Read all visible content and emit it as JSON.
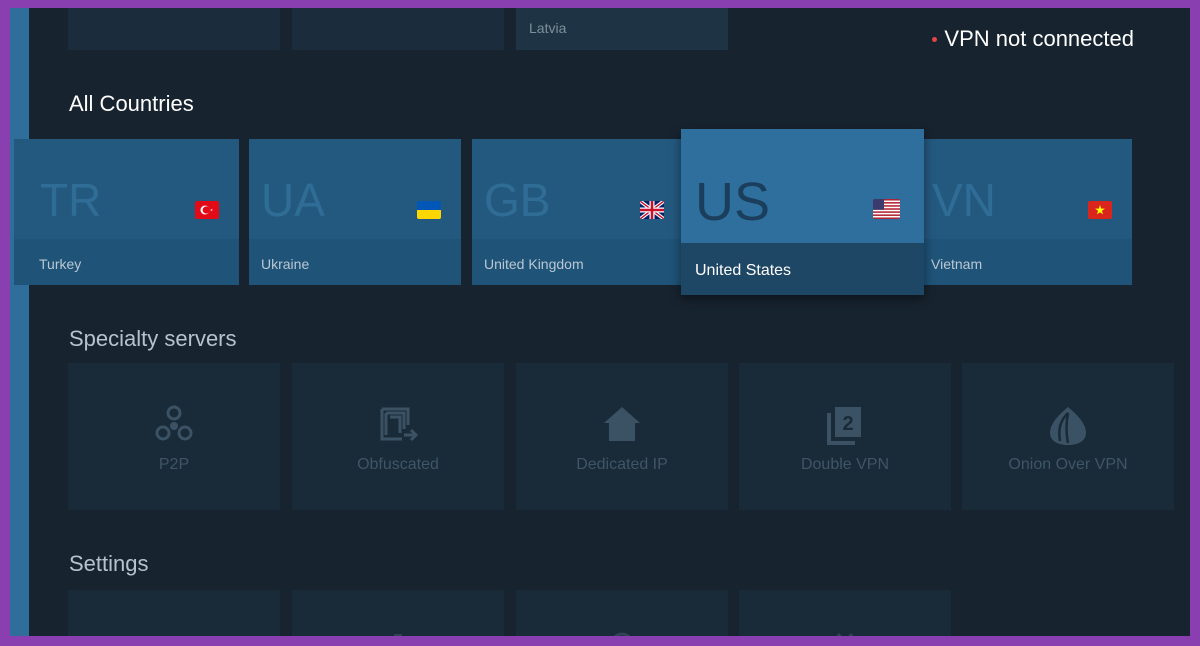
{
  "top_row": {
    "tiles": [
      {
        "label": ""
      },
      {
        "label": ""
      },
      {
        "label": "Latvia"
      }
    ]
  },
  "status": {
    "text": "VPN not connected",
    "dot_color": "#e5434a"
  },
  "sections": {
    "countries_title": "All Countries",
    "specialty_title": "Specialty servers",
    "settings_title": "Settings"
  },
  "countries": [
    {
      "code": "TR",
      "name": "Turkey",
      "flag": "flag-tr-icon"
    },
    {
      "code": "UA",
      "name": "Ukraine",
      "flag": "flag-ua-icon"
    },
    {
      "code": "GB",
      "name": "United Kingdom",
      "flag": "flag-gb-icon"
    },
    {
      "code": "US",
      "name": "United States",
      "flag": "flag-us-icon",
      "focused": true
    },
    {
      "code": "VN",
      "name": "Vietnam",
      "flag": "flag-vn-icon"
    }
  ],
  "specialty": [
    {
      "label": "P2P",
      "icon": "p2p-icon"
    },
    {
      "label": "Obfuscated",
      "icon": "obfuscated-icon"
    },
    {
      "label": "Dedicated IP",
      "icon": "house-icon"
    },
    {
      "label": "Double VPN",
      "icon": "double-vpn-icon"
    },
    {
      "label": "Onion Over VPN",
      "icon": "onion-icon"
    }
  ],
  "settings": [
    {
      "icon": "settings-item-icon"
    },
    {
      "icon": "settings-item-icon"
    },
    {
      "icon": "settings-item-icon"
    },
    {
      "icon": "settings-item-icon"
    }
  ],
  "colors": {
    "background": "#17232f",
    "accent": "#2f6e9b",
    "focused_card": "#2e6f9d",
    "border": "#8a3fb0"
  }
}
